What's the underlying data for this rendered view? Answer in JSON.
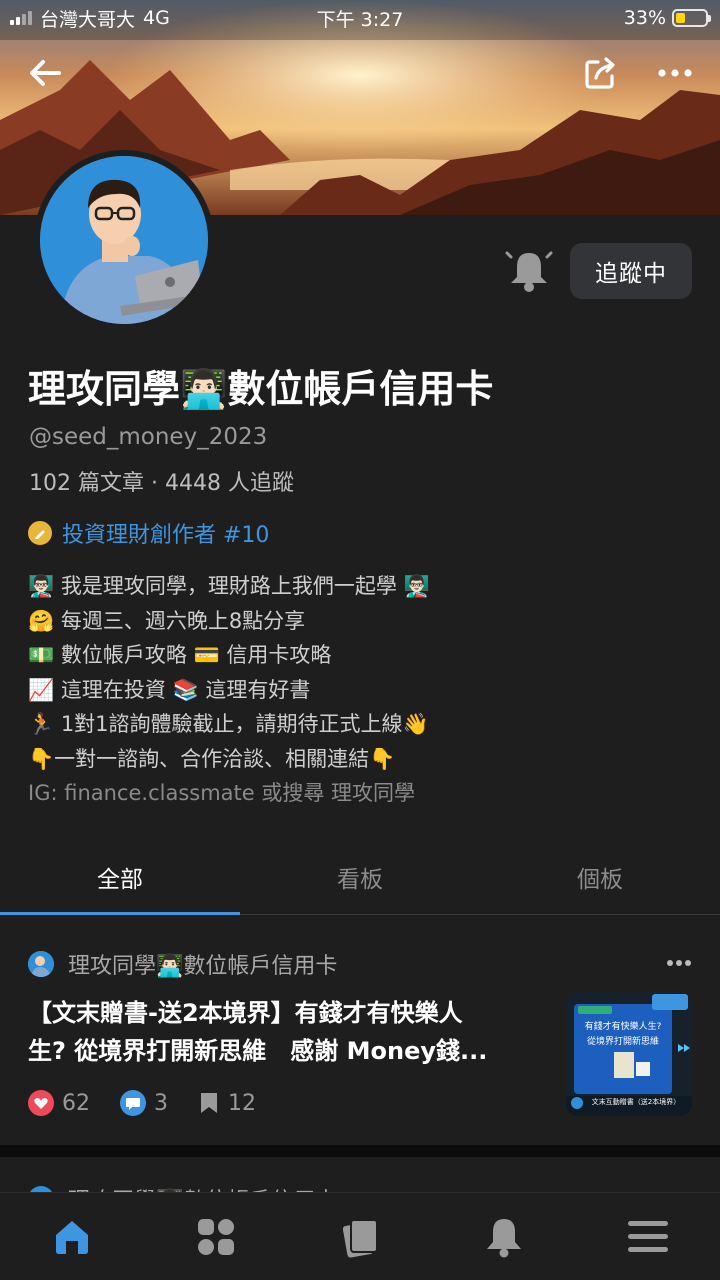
{
  "status_bar": {
    "carrier": "台灣大哥大",
    "network": "4G",
    "time": "下午 3:27",
    "battery_text": "33%",
    "battery_level": 0.33
  },
  "header": {
    "back_icon": "arrow-left-icon",
    "share_icon": "share-icon",
    "more_icon": "more-dots-icon"
  },
  "profile": {
    "name": "理攻同學👨🏻‍💻數位帳戶信用卡",
    "handle": "@seed_money_2023",
    "stats": "102 篇文章 · 4448 人追蹤",
    "badge_text": "投資理財創作者 #10",
    "follow_label": "追蹤中",
    "bio": [
      "👨🏻‍🏫 我是理攻同學，理財路上我們一起學 👨🏻‍🏫",
      "🤗 每週三、週六晚上8點分享",
      "💵 數位帳戶攻略 💳 信用卡攻略",
      "📈 這理在投資 📚 這理有好書",
      "🏃 1對1諮詢體驗截止，請期待正式上線👋",
      "👇一對一諮詢、合作洽談、相關連結👇",
      "IG: finance.classmate 或搜尋 理攻同學"
    ]
  },
  "tabs": [
    {
      "label": "全部",
      "active": true
    },
    {
      "label": "看板",
      "active": false
    },
    {
      "label": "個板",
      "active": false
    }
  ],
  "post": {
    "author": "理攻同學👨🏻‍💻數位帳戶信用卡",
    "title_line1": "【文末贈書-送2本境界】有錢才有快樂人",
    "title_line2": "生? 從境界打開新思維　感謝 Money錢...",
    "likes": "62",
    "comments": "3",
    "bookmarks": "12",
    "thumb_text_1": "有錢才有快樂人生?",
    "thumb_text_2": "從境界打開新思維",
    "thumb_footer": "文末互動贈書（送2本境界）"
  },
  "next_post_author": "理攻同學👨🏻‍💻數位帳戶信用卡",
  "bottom_nav": [
    {
      "icon": "home-icon",
      "active": true
    },
    {
      "icon": "grid-icon",
      "active": false
    },
    {
      "icon": "cards-icon",
      "active": false
    },
    {
      "icon": "bell-icon",
      "active": false
    },
    {
      "icon": "menu-icon",
      "active": false
    }
  ],
  "colors": {
    "background": "#1e1e1e",
    "accent": "#3e95e0",
    "like": "#ef4a5a",
    "comment": "#3e95e0"
  }
}
